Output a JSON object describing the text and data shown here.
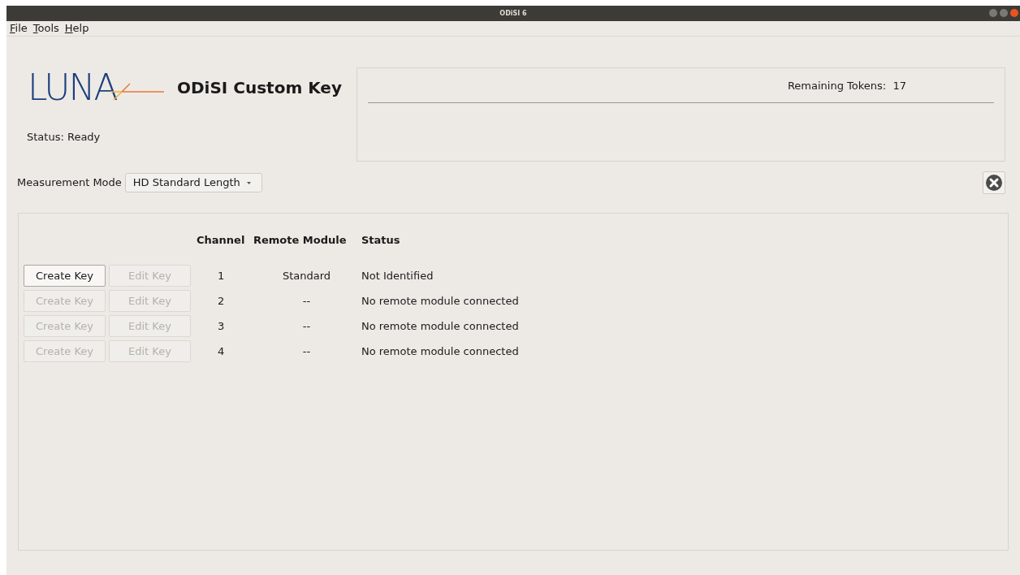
{
  "window": {
    "title": "ODiSI 6"
  },
  "menu": [
    {
      "label": "File"
    },
    {
      "label": "Tools"
    },
    {
      "label": "Help"
    }
  ],
  "logo": {
    "text": "LUNA"
  },
  "app_title": "ODiSI Custom Key",
  "status": "Status: Ready",
  "tokens": {
    "label": "Remaining Tokens:",
    "value": "17"
  },
  "measurement_mode": {
    "label": "Measurement Mode",
    "value": "HD Standard Length"
  },
  "table": {
    "columns": [
      "Channel",
      "Remote Module",
      "Status"
    ],
    "rows": [
      {
        "create_key": {
          "label": "Create Key",
          "disabled": false
        },
        "edit_key": {
          "label": "Edit Key",
          "disabled": true
        },
        "channel": "1",
        "remote_module": "Standard",
        "status": "Not Identified"
      },
      {
        "create_key": {
          "label": "Create Key",
          "disabled": true
        },
        "edit_key": {
          "label": "Edit Key",
          "disabled": true
        },
        "channel": "2",
        "remote_module": "--",
        "status": "No remote module connected"
      },
      {
        "create_key": {
          "label": "Create Key",
          "disabled": true
        },
        "edit_key": {
          "label": "Edit Key",
          "disabled": true
        },
        "channel": "3",
        "remote_module": "--",
        "status": "No remote module connected"
      },
      {
        "create_key": {
          "label": "Create Key",
          "disabled": true
        },
        "edit_key": {
          "label": "Edit Key",
          "disabled": true
        },
        "channel": "4",
        "remote_module": "--",
        "status": "No remote module connected"
      }
    ]
  }
}
